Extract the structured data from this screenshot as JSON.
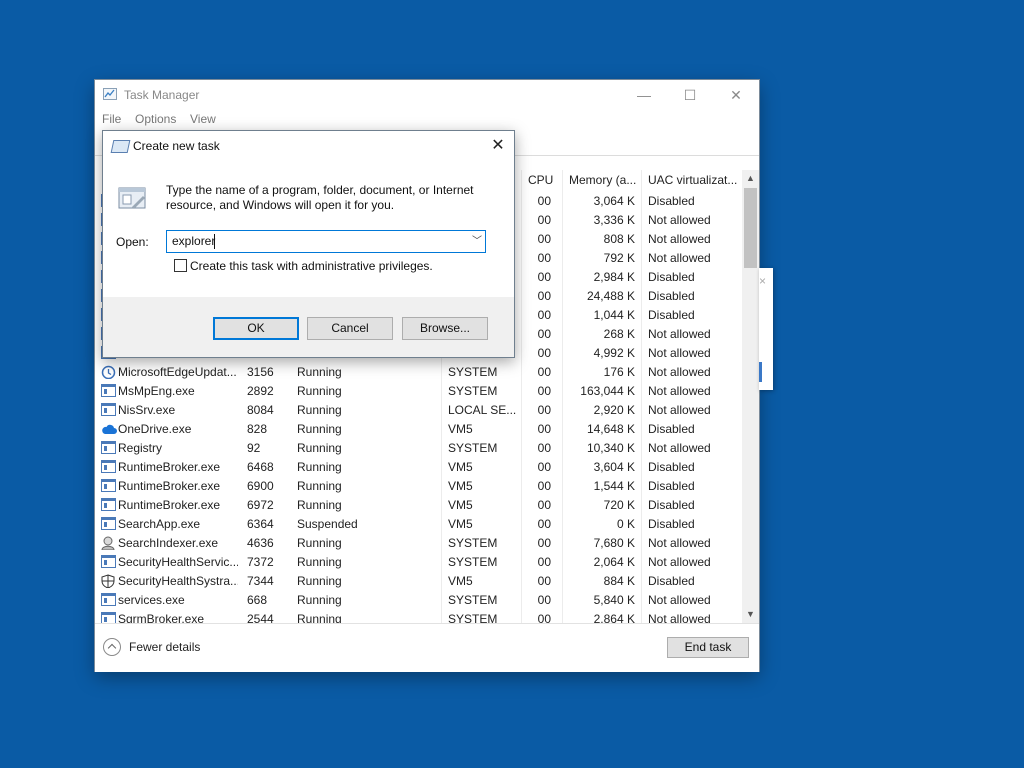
{
  "task_manager": {
    "title": "Task Manager",
    "window_controls": {
      "minimize": "—",
      "maximize": "☐",
      "close": "✕"
    },
    "menu": [
      "File",
      "Options",
      "View"
    ],
    "columns": {
      "cpu": "CPU",
      "memory": "Memory (a...",
      "uac": "UAC virtualizat..."
    },
    "rows": [
      {
        "name": "",
        "pid": "",
        "status": "",
        "user": "",
        "cpu": "00",
        "memory": "3,064 K",
        "uac": "Disabled",
        "icon": "app-icon"
      },
      {
        "name": "",
        "pid": "",
        "status": "",
        "user": "",
        "cpu": "00",
        "memory": "3,336 K",
        "uac": "Not allowed",
        "icon": "app-icon"
      },
      {
        "name": "",
        "pid": "",
        "status": "",
        "user": "",
        "cpu": "00",
        "memory": "808 K",
        "uac": "Not allowed",
        "icon": "app-icon"
      },
      {
        "name": "",
        "pid": "",
        "status": "",
        "user": "",
        "cpu": "00",
        "memory": "792 K",
        "uac": "Not allowed",
        "icon": "app-icon"
      },
      {
        "name": "",
        "pid": "",
        "status": "",
        "user": "",
        "cpu": "00",
        "memory": "2,984 K",
        "uac": "Disabled",
        "icon": "app-icon"
      },
      {
        "name": "",
        "pid": "",
        "status": "",
        "user": "",
        "cpu": "00",
        "memory": "24,488 K",
        "uac": "Disabled",
        "icon": "app-icon"
      },
      {
        "name": "",
        "pid": "",
        "status": "",
        "user": "",
        "cpu": "00",
        "memory": "1,044 K",
        "uac": "Disabled",
        "icon": "app-icon"
      },
      {
        "name": "",
        "pid": "",
        "status": "",
        "user": "",
        "cpu": "00",
        "memory": "268 K",
        "uac": "Not allowed",
        "icon": "app-icon"
      },
      {
        "name": "",
        "pid": "",
        "status": "",
        "user": "",
        "cpu": "00",
        "memory": "4,992 K",
        "uac": "Not allowed",
        "icon": "app-icon"
      },
      {
        "name": "MicrosoftEdgeUpdat...",
        "pid": "3156",
        "status": "Running",
        "user": "SYSTEM",
        "cpu": "00",
        "memory": "176 K",
        "uac": "Not allowed",
        "icon": "edge-update-icon"
      },
      {
        "name": "MsMpEng.exe",
        "pid": "2892",
        "status": "Running",
        "user": "SYSTEM",
        "cpu": "00",
        "memory": "163,044 K",
        "uac": "Not allowed",
        "icon": "app-icon"
      },
      {
        "name": "NisSrv.exe",
        "pid": "8084",
        "status": "Running",
        "user": "LOCAL SE...",
        "cpu": "00",
        "memory": "2,920 K",
        "uac": "Not allowed",
        "icon": "app-icon"
      },
      {
        "name": "OneDrive.exe",
        "pid": "828",
        "status": "Running",
        "user": "VM5",
        "cpu": "00",
        "memory": "14,648 K",
        "uac": "Disabled",
        "icon": "onedrive-icon"
      },
      {
        "name": "Registry",
        "pid": "92",
        "status": "Running",
        "user": "SYSTEM",
        "cpu": "00",
        "memory": "10,340 K",
        "uac": "Not allowed",
        "icon": "app-icon"
      },
      {
        "name": "RuntimeBroker.exe",
        "pid": "6468",
        "status": "Running",
        "user": "VM5",
        "cpu": "00",
        "memory": "3,604 K",
        "uac": "Disabled",
        "icon": "app-icon"
      },
      {
        "name": "RuntimeBroker.exe",
        "pid": "6900",
        "status": "Running",
        "user": "VM5",
        "cpu": "00",
        "memory": "1,544 K",
        "uac": "Disabled",
        "icon": "app-icon"
      },
      {
        "name": "RuntimeBroker.exe",
        "pid": "6972",
        "status": "Running",
        "user": "VM5",
        "cpu": "00",
        "memory": "720 K",
        "uac": "Disabled",
        "icon": "app-icon"
      },
      {
        "name": "SearchApp.exe",
        "pid": "6364",
        "status": "Suspended",
        "user": "VM5",
        "cpu": "00",
        "memory": "0 K",
        "uac": "Disabled",
        "icon": "app-icon"
      },
      {
        "name": "SearchIndexer.exe",
        "pid": "4636",
        "status": "Running",
        "user": "SYSTEM",
        "cpu": "00",
        "memory": "7,680 K",
        "uac": "Not allowed",
        "icon": "search-indexer-icon"
      },
      {
        "name": "SecurityHealthServic...",
        "pid": "7372",
        "status": "Running",
        "user": "SYSTEM",
        "cpu": "00",
        "memory": "2,064 K",
        "uac": "Not allowed",
        "icon": "app-icon"
      },
      {
        "name": "SecurityHealthSystra...",
        "pid": "7344",
        "status": "Running",
        "user": "VM5",
        "cpu": "00",
        "memory": "884 K",
        "uac": "Disabled",
        "icon": "shield-icon"
      },
      {
        "name": "services.exe",
        "pid": "668",
        "status": "Running",
        "user": "SYSTEM",
        "cpu": "00",
        "memory": "5,840 K",
        "uac": "Not allowed",
        "icon": "app-icon"
      },
      {
        "name": "SgrmBroker.exe",
        "pid": "2544",
        "status": "Running",
        "user": "SYSTEM",
        "cpu": "00",
        "memory": "2,864 K",
        "uac": "Not allowed",
        "icon": "app-icon"
      }
    ],
    "footer": {
      "fewer_details": "Fewer details",
      "end_task": "End task"
    }
  },
  "dialog": {
    "title": "Create new task",
    "close": "✕",
    "description": "Type the name of a program, folder, document, or Internet resource, and Windows will open it for you.",
    "open_label": "Open:",
    "open_value": "explorer",
    "admin_label": "Create this task with administrative privileges.",
    "admin_checked": false,
    "buttons": {
      "ok": "OK",
      "cancel": "Cancel",
      "browse": "Browse..."
    }
  },
  "colors": {
    "desktop": "#0a5ba5",
    "accent": "#0078d7"
  }
}
